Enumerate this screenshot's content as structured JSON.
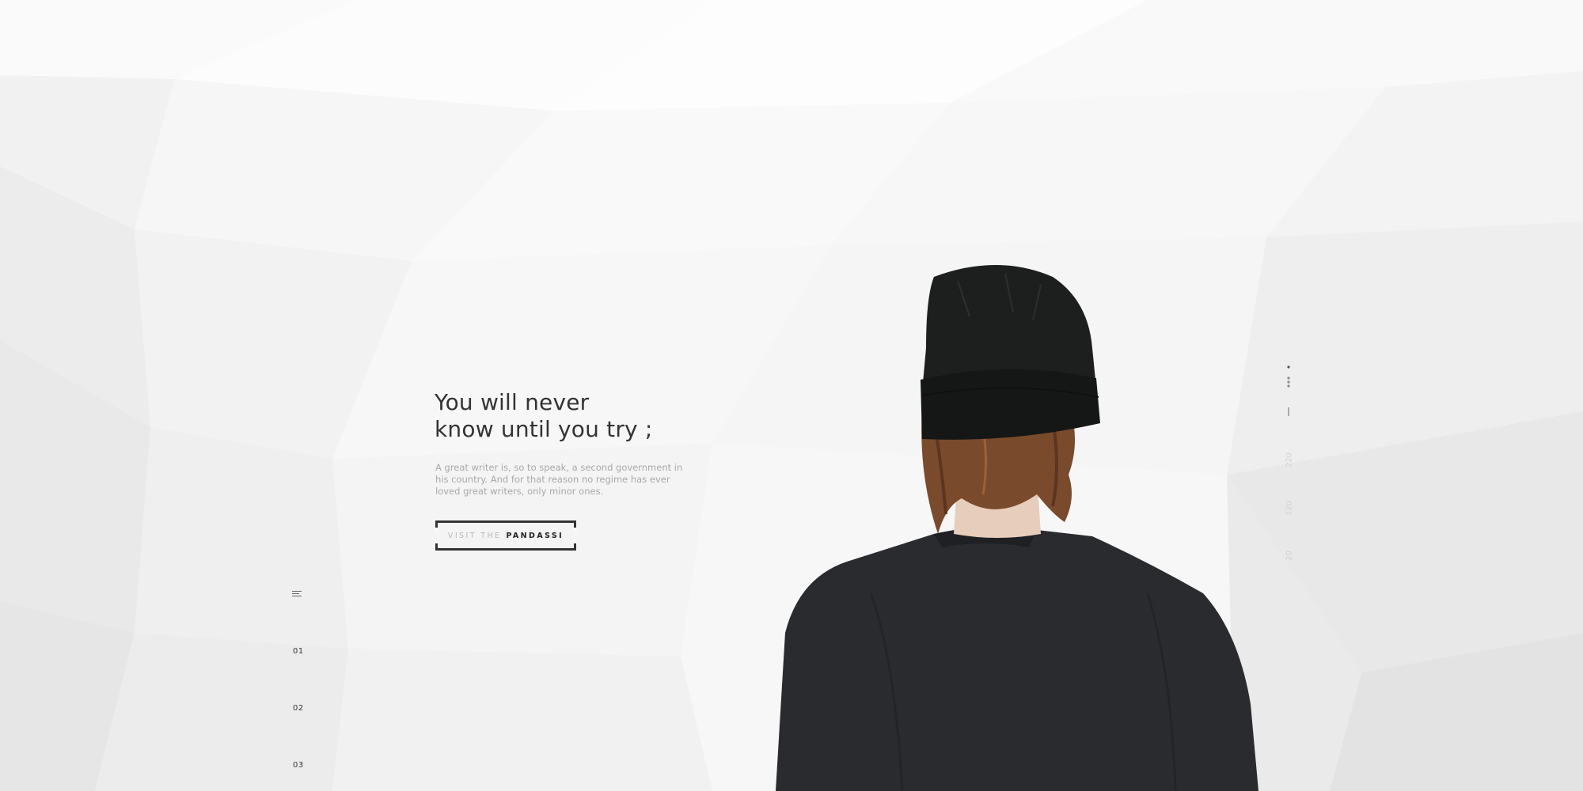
{
  "hero": {
    "title_line1": "You will never",
    "title_line2": "know until you try ;",
    "description": "A great writer is, so to speak, a second government in his country. And for that reason no regime has ever loved great writers, only minor ones."
  },
  "cta": {
    "prefix": "VISIT THE",
    "brand": "PANDASSI"
  },
  "side_nav": {
    "menu_icon": "menu-icon",
    "items": [
      "01",
      "02",
      "03"
    ]
  },
  "right_strip": {
    "numbers": [
      "220",
      "120",
      "20"
    ]
  },
  "colors": {
    "background": "#f6f6f6",
    "text_dark": "#333333",
    "text_muted": "#a9a9a9",
    "numbers_faint": "#d2d2d2"
  }
}
